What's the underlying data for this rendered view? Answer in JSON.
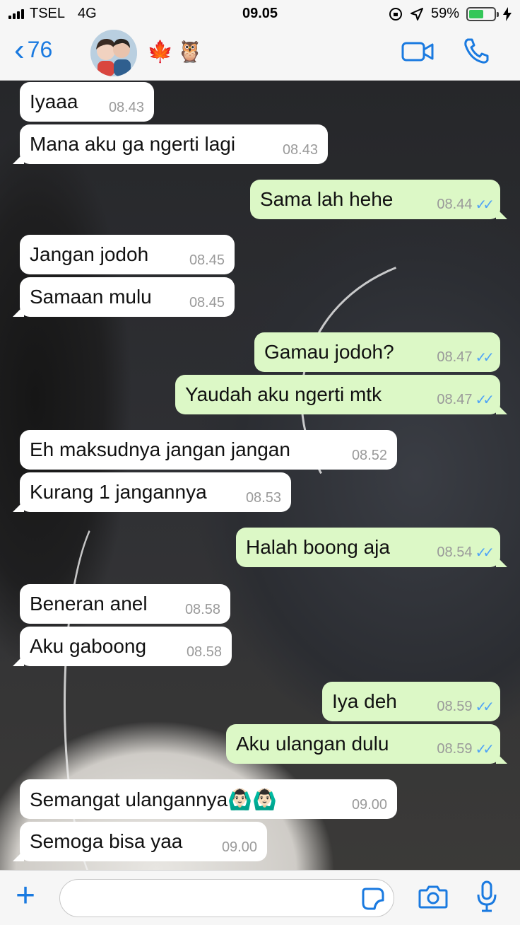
{
  "status_bar": {
    "carrier": "TSEL",
    "network": "4G",
    "time": "09.05",
    "battery_percent": "59%",
    "battery_level": 0.59
  },
  "header": {
    "back_count": "76",
    "contact_emojis": [
      "🍁",
      "🦉"
    ]
  },
  "messages": [
    {
      "dir": "in",
      "text": "Iyaaa",
      "time": "08.43"
    },
    {
      "dir": "in",
      "text": "Mana aku ga ngerti lagi",
      "time": "08.43"
    },
    {
      "dir": "out",
      "text": "Sama lah hehe",
      "time": "08.44"
    },
    {
      "dir": "in",
      "text": "Jangan jodoh",
      "time": "08.45"
    },
    {
      "dir": "in",
      "text": "Samaan mulu",
      "time": "08.45"
    },
    {
      "dir": "out",
      "text": "Gamau jodoh?",
      "time": "08.47"
    },
    {
      "dir": "out",
      "text": "Yaudah aku ngerti mtk",
      "time": "08.47"
    },
    {
      "dir": "in",
      "text": "Eh maksudnya jangan jangan",
      "time": "08.52"
    },
    {
      "dir": "in",
      "text": "Kurang 1 jangannya",
      "time": "08.53"
    },
    {
      "dir": "out",
      "text": "Halah boong aja",
      "time": "08.54"
    },
    {
      "dir": "in",
      "text": "Beneran anel",
      "time": "08.58"
    },
    {
      "dir": "in",
      "text": "Aku gaboong",
      "time": "08.58"
    },
    {
      "dir": "out",
      "text": "Iya deh",
      "time": "08.59"
    },
    {
      "dir": "out",
      "text": "Aku ulangan dulu",
      "time": "08.59"
    },
    {
      "dir": "in",
      "text": "Semangat ulangannya🙆🏻‍♂️🙆🏻‍♂️",
      "time": "09.00"
    },
    {
      "dir": "in",
      "text": "Semoga bisa yaa",
      "time": "09.00"
    }
  ],
  "composer": {
    "placeholder": ""
  },
  "colors": {
    "accent": "#1a7ae0",
    "incoming_bubble": "#ffffff",
    "outgoing_bubble": "#dcf8c6",
    "read_ticks": "#4fa3f7"
  },
  "icons": {
    "back": "chevron-left-icon",
    "video": "video-camera-icon",
    "call": "phone-icon",
    "attach": "plus-icon",
    "sticker": "sticker-icon",
    "camera": "camera-icon",
    "mic": "microphone-icon"
  }
}
